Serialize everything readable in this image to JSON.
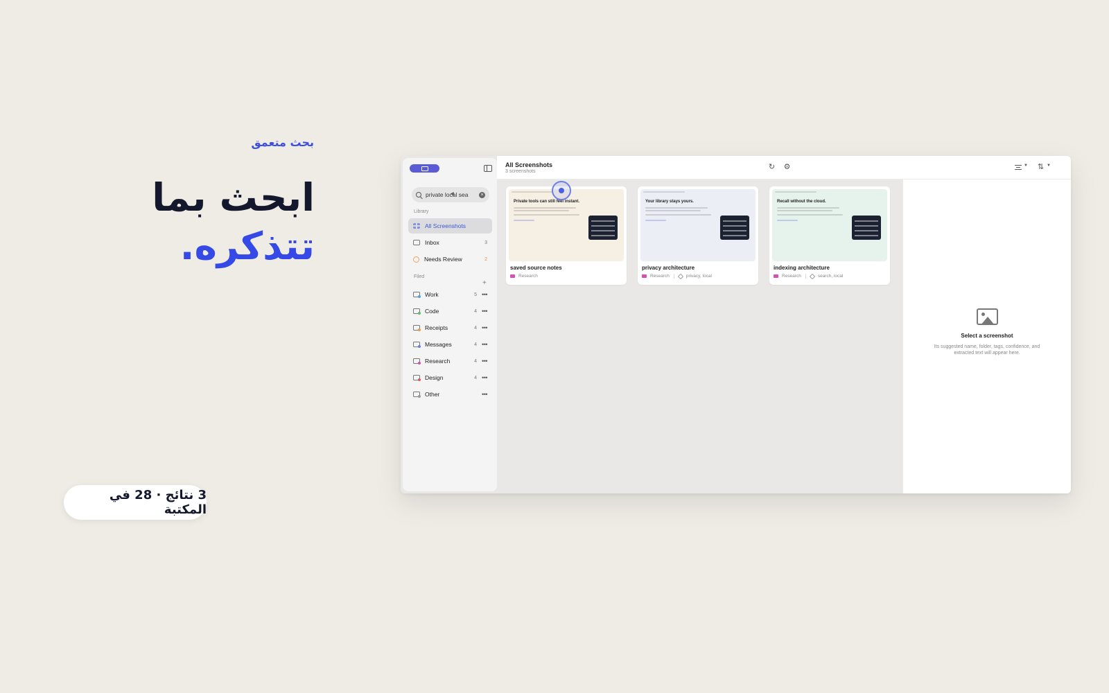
{
  "promo": {
    "eyebrow": "بحث متعمق",
    "headline_line1": "ابحث بما",
    "headline_line2": "تتذكره.",
    "results_pill": "3 نتائج · 28 في المكتبة"
  },
  "sidebar": {
    "search": {
      "value": "private local sea",
      "placeholder": "Search"
    },
    "library_label": "Library",
    "library_items": [
      {
        "label": "All Screenshots",
        "count": "",
        "active": true
      },
      {
        "label": "Inbox",
        "count": "3"
      },
      {
        "label": "Needs Review",
        "count": "2"
      }
    ],
    "filed_label": "Filed",
    "add_icon": "plus-icon",
    "folders": [
      {
        "label": "Work",
        "count": "5",
        "color": "#4aa6e0"
      },
      {
        "label": "Code",
        "count": "4",
        "color": "#5bbf6a"
      },
      {
        "label": "Receipts",
        "count": "4",
        "color": "#e0a04a"
      },
      {
        "label": "Messages",
        "count": "4",
        "color": "#6b7fe6"
      },
      {
        "label": "Research",
        "count": "4",
        "color": "#d64fb1"
      },
      {
        "label": "Design",
        "count": "4",
        "color": "#e05a5a"
      },
      {
        "label": "Other",
        "count": "",
        "color": "#999999"
      }
    ]
  },
  "topbar": {
    "title": "All Screenshots",
    "subtitle": "3 screenshots",
    "icons": [
      "refresh-icon",
      "gear-icon",
      "filter-icon",
      "sort-icon"
    ]
  },
  "cards": [
    {
      "title": "saved source notes",
      "folder": "Research",
      "tags": "",
      "thumb_headline": "Private tools can still feel instant.",
      "thumb_bg": "#f6efe3"
    },
    {
      "title": "privacy architecture",
      "folder": "Research",
      "tags": "privacy, local",
      "thumb_headline": "Your library stays yours.",
      "thumb_bg": "#eceef6"
    },
    {
      "title": "indexing architecture",
      "folder": "Research",
      "tags": "search, local",
      "thumb_headline": "Recall without the cloud.",
      "thumb_bg": "#e6f3ec"
    }
  ],
  "detail": {
    "icon": "image-icon",
    "title": "Select a screenshot",
    "text": "Its suggested name, folder, tags, confidence, and extracted text will appear here."
  }
}
